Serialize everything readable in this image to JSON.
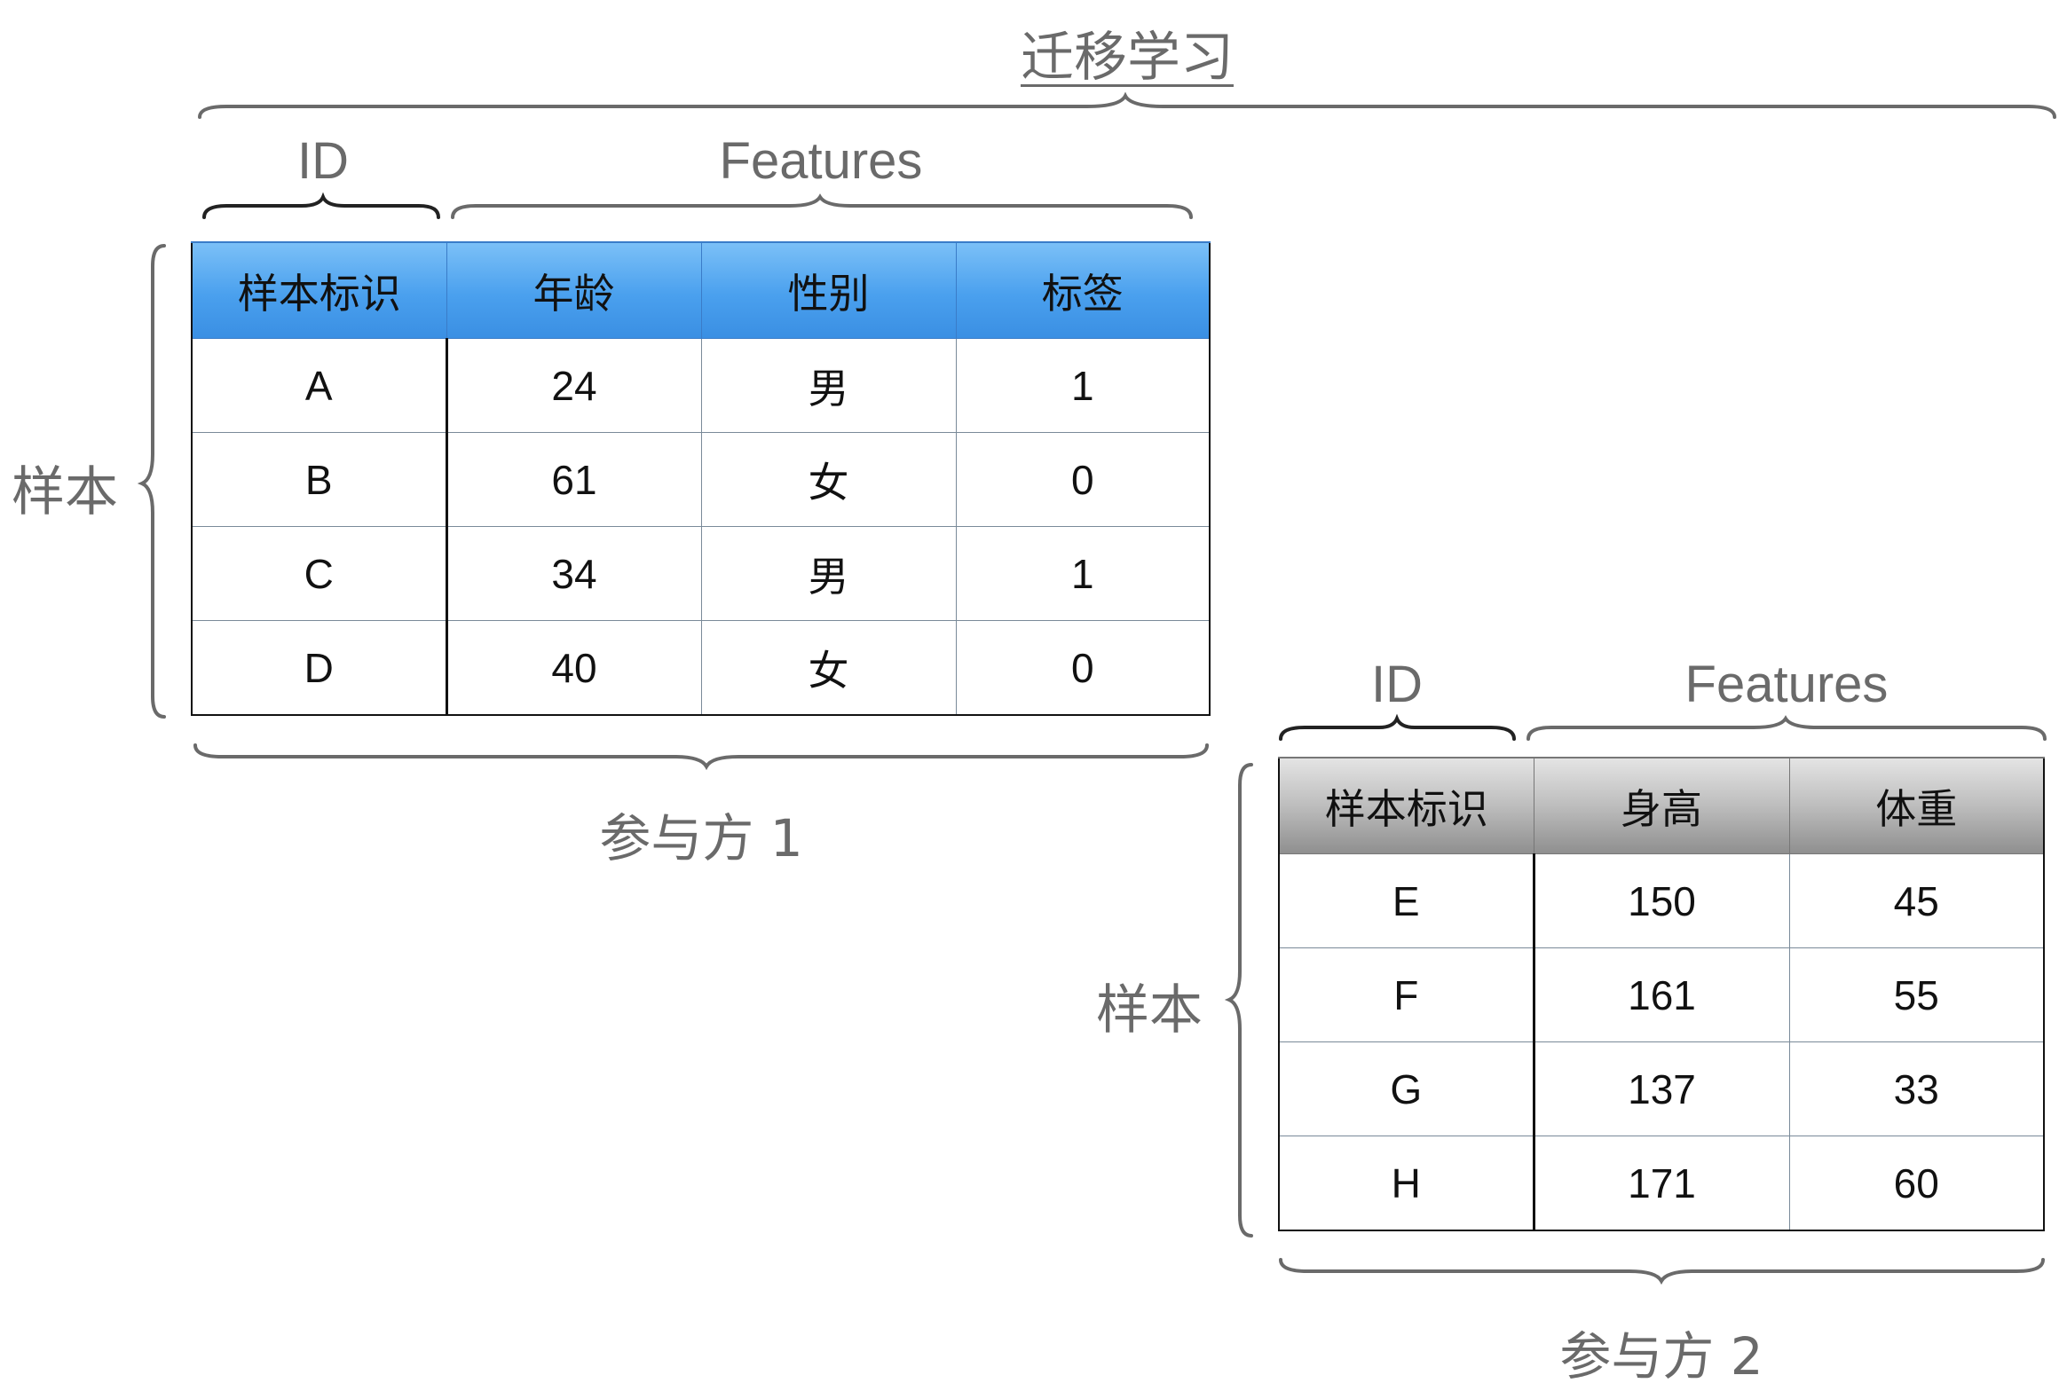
{
  "title": "迁移学习",
  "party1": {
    "id_label": "ID",
    "features_label": "Features",
    "samples_label": "样本",
    "party_label": "参与方 1",
    "colors": {
      "header_top": "#7bc0f7",
      "header_bottom": "#3a8fe3"
    },
    "headers": [
      "样本标识",
      "年龄",
      "性别",
      "标签"
    ],
    "rows": [
      [
        "A",
        "24",
        "男",
        "1"
      ],
      [
        "B",
        "61",
        "女",
        "0"
      ],
      [
        "C",
        "34",
        "男",
        "1"
      ],
      [
        "D",
        "40",
        "女",
        "0"
      ]
    ]
  },
  "party2": {
    "id_label": "ID",
    "features_label": "Features",
    "samples_label": "样本",
    "party_label": "参与方 2",
    "colors": {
      "header_top": "#e4e4e4",
      "header_bottom": "#8f8f8f"
    },
    "headers": [
      "样本标识",
      "身高",
      "体重"
    ],
    "rows": [
      [
        "E",
        "150",
        "45"
      ],
      [
        "F",
        "161",
        "55"
      ],
      [
        "G",
        "137",
        "33"
      ],
      [
        "H",
        "171",
        "60"
      ]
    ]
  }
}
